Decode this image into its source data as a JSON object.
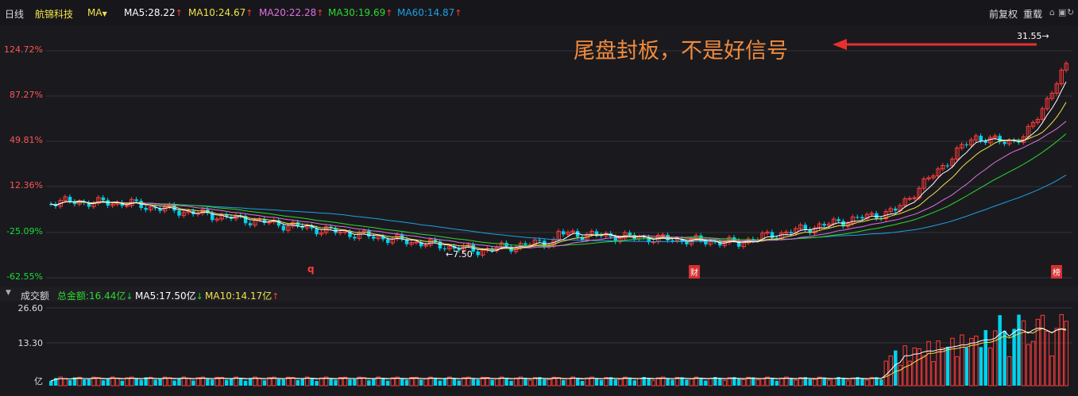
{
  "header": {
    "period": "日线",
    "stock_name": "航锦科技",
    "indicator": "MA",
    "ma5_label": "MA5:28.22",
    "ma10_label": "MA10:24.67",
    "ma20_label": "MA20:22.28",
    "ma30_label": "MA30:19.69",
    "ma60_label": "MA60:14.87",
    "adjust": "前复权",
    "overlay": "重载",
    "up_arrow": "↑",
    "down_arrow": "↓"
  },
  "colors": {
    "up": "#ff3b3b",
    "down": "#00d2ee",
    "ma5": "#ffffff",
    "ma10": "#f2e24b",
    "ma20": "#e070e0",
    "ma30": "#2fd82f",
    "ma60": "#1e9fe8",
    "annotation": "#f08a3c"
  },
  "price_axis": {
    "ticks": [
      "124.72%",
      "87.27%",
      "49.81%",
      "12.36%",
      "-25.09%",
      "-62.55%"
    ]
  },
  "annotations": {
    "main_text": "尾盘封板，不是好信号",
    "high_label": "31.55→",
    "low_label": "←7.50",
    "marker_q": "q",
    "marker_cai": "财",
    "marker_bang": "榜"
  },
  "volume": {
    "title": "成交额",
    "total_label": "总金额:16.44亿",
    "ma5_label": "MA5:17.50亿",
    "ma10_label": "MA10:14.17亿",
    "ticks": [
      "26.60",
      "13.30",
      "亿"
    ]
  },
  "chart_data": {
    "type": "candlestick",
    "title": "航锦科技",
    "y_axis_label": "",
    "ylim_percent": [
      -62.55,
      124.72
    ],
    "high_price": 31.55,
    "low_price": 7.5,
    "volume_ylim": [
      0,
      26.6
    ],
    "volume_unit": "亿",
    "ma_latest": {
      "ma5": 28.22,
      "ma10": 24.67,
      "ma20": 22.28,
      "ma30": 19.69,
      "ma60": 14.87
    },
    "volume_latest": {
      "total": 16.44,
      "ma5": 17.5,
      "ma10": 14.17
    }
  }
}
